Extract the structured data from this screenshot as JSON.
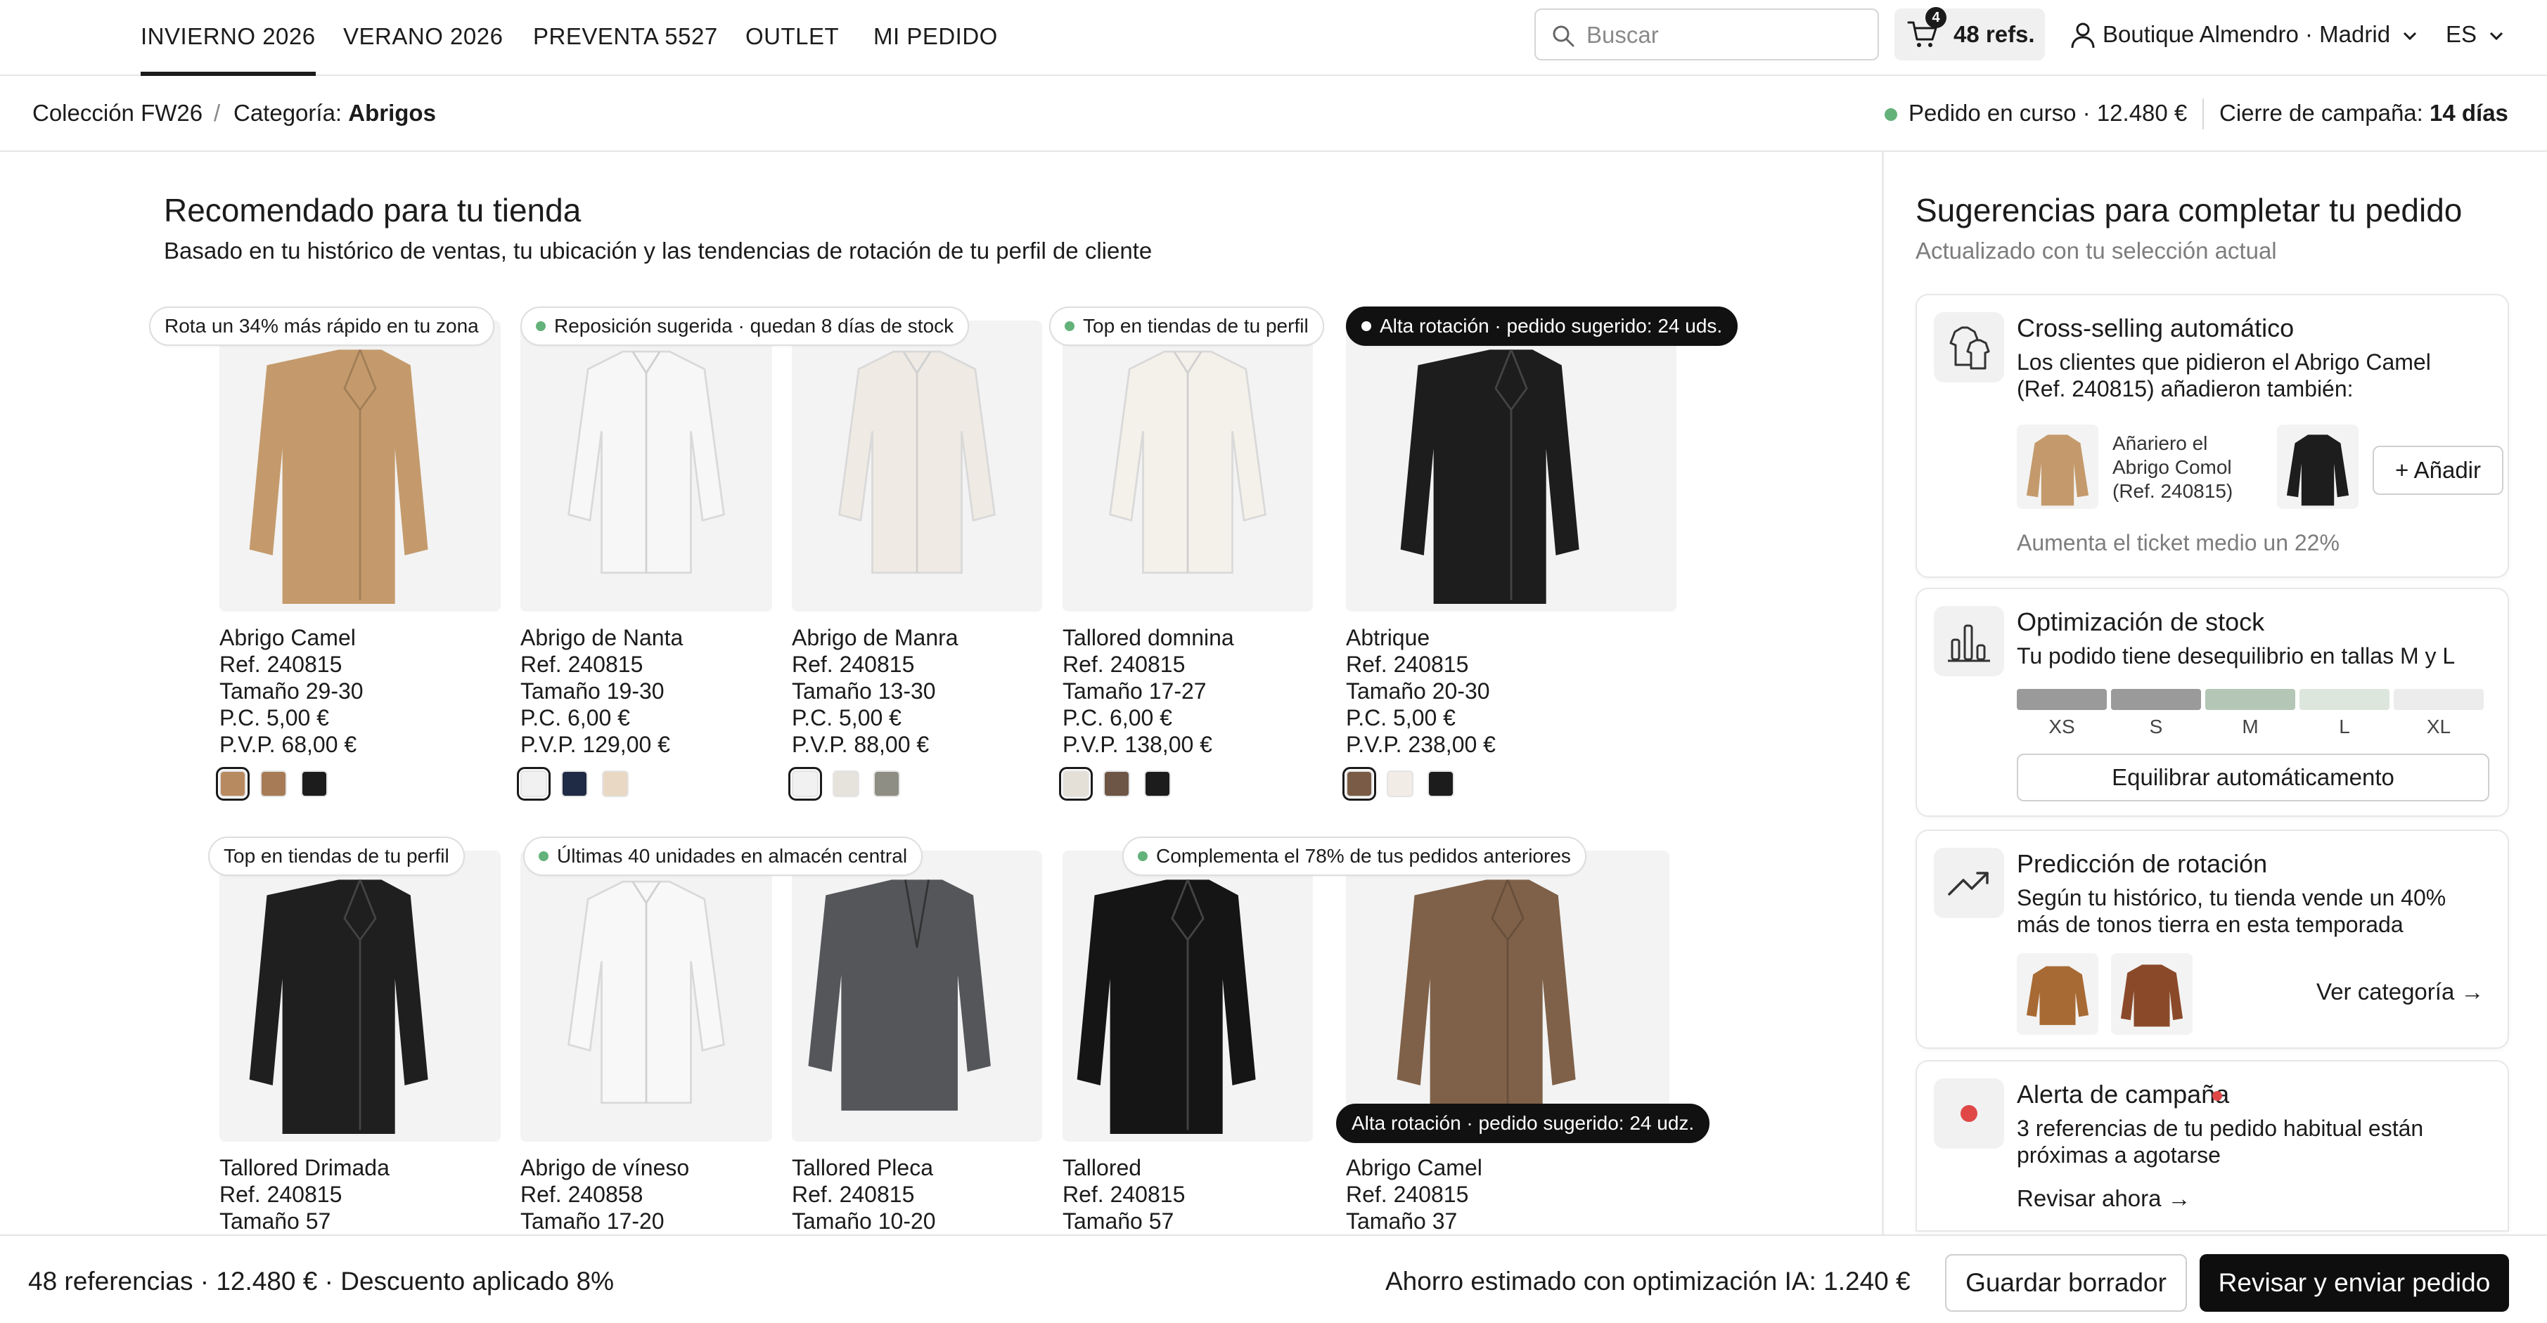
{
  "nav": {
    "tabs": [
      "INVIERNO 2026",
      "VERANO 2026",
      "PREVENTA 5527",
      "OUTLET",
      "MI PEDIDO"
    ],
    "search_placeholder": "Buscar",
    "cart_count": "4",
    "cart_label": "48 refs.",
    "store": "Boutique Almendro · Madrid",
    "lang": "ES"
  },
  "breadcrumb": {
    "collection": "Colección FW26",
    "sep": "/",
    "category_label": "Categoría:",
    "category_value": "Abrigos",
    "order_status": "Pedido en curso · 12.480 €",
    "campaign_label": "Cierre de campaña:",
    "campaign_value": "14 días"
  },
  "main": {
    "title": "Recomendado para tu tienda",
    "subtitle": "Basado en tu histórico de ventas, tu ubicación y las tendencias de rotación de tu perfil de cliente",
    "pills_row1": [
      {
        "text": "Rota un 34% más rápido en tu zona",
        "dot": false,
        "dark": false
      },
      {
        "text": "Reposición sugerida · quedan 8 días de stock",
        "dot": true,
        "dark": false
      },
      {
        "text": "Top en tiendas de tu perfil",
        "dot": true,
        "dark": false
      },
      {
        "text": "Alta rotación · pedido sugerido: 24 uds.",
        "dot": true,
        "dark": true
      }
    ],
    "pills_row2": [
      {
        "text": "Top en tiendas de tu perfil",
        "dot": false,
        "dark": false
      },
      {
        "text": "Últimas 40 unidades en almacén central",
        "dot": true,
        "dark": false
      },
      {
        "text": "Complementa el 78% de tus pedidos anteriores",
        "dot": true,
        "dark": false
      },
      {
        "text": "Alta rotación · pedido sugerido: 24 udz.",
        "dot": false,
        "dark": true
      }
    ],
    "products_row1": [
      {
        "name": "Abrigo Camel",
        "ref": "Ref. 240815",
        "size": "Tamaño 29-30",
        "pc": "P.C. 5,00 €",
        "pvp": "P.V.P. 68,00 €",
        "garment": "coat",
        "color": "#c49a6c",
        "swatches": [
          "#b88a5f",
          "#a77b56",
          "#1c1c1c"
        ]
      },
      {
        "name": "Abrigo de Nanta",
        "ref": "Ref. 240815",
        "size": "Tamaño 19-30",
        "pc": "P.C. 6,00 €",
        "pvp": "P.V.P. 129,00 €",
        "garment": "shirt",
        "color": "#f7f7f7",
        "swatches": [
          "#f1f1f1",
          "#1f2a44",
          "#e8d8c4"
        ]
      },
      {
        "name": "Abrigo de Manra",
        "ref": "Ref. 240815",
        "size": "Tamaño 13-30",
        "pc": "P.C. 5,00 €",
        "pvp": "P.V.P. 88,00 €",
        "garment": "shirt",
        "color": "#efebe4",
        "swatches": [
          "#f1f1f1",
          "#e6e2dc",
          "#8e8e84"
        ]
      },
      {
        "name": "Tallored domnina",
        "ref": "Ref. 240815",
        "size": "Tamaño 17-27",
        "pc": "P.C. 6,00 €",
        "pvp": "P.V.P. 138,00 €",
        "garment": "shirt",
        "color": "#f4f1ea",
        "swatches": [
          "#e4e0d8",
          "#6e5646",
          "#1c1c1c"
        ]
      },
      {
        "name": "Abtrique",
        "ref": "Ref. 240815",
        "size": "Tamaño 20-30",
        "pc": "P.C. 5,00 €",
        "pvp": "P.V.P. 238,00 €",
        "garment": "coat",
        "color": "#1d1d1d",
        "swatches": [
          "#7a5b45",
          "#f1ede6",
          "#1c1c1c"
        ]
      }
    ],
    "products_row2": [
      {
        "name": "Tallored Drimada",
        "ref": "Ref. 240815",
        "size": "Tamaño 57",
        "garment": "coat",
        "color": "#1f1f1f"
      },
      {
        "name": "Abrigo de víneso",
        "ref": "Ref. 240858",
        "size": "Tamaño 17-20",
        "garment": "shirt",
        "color": "#f8f8f8"
      },
      {
        "name": "Tallored Pleca",
        "ref": "Ref. 240815",
        "size": "Tamaño 10-20",
        "garment": "blazer",
        "color": "#55565a"
      },
      {
        "name": "Tallored",
        "ref": "Ref. 240815",
        "size": "Tamaño 57",
        "garment": "coat",
        "color": "#151515"
      },
      {
        "name": "Abrigo Camel",
        "ref": "Ref. 240815",
        "size": "Tamaño 37",
        "garment": "coat",
        "color": "#7f6149"
      }
    ]
  },
  "side": {
    "title": "Sugerencias para completar tu pedido",
    "subtitle": "Actualizado con tu selección actual",
    "cross": {
      "title": "Cross-selling automático",
      "text1": "Los clientes que pidieron el Abrigo Camel",
      "text2": "(Ref. 240815) añadieron también:",
      "item_l1": "Añariero el",
      "item_l2": "Abrigo Comol",
      "item_l3": "(Ref. 240815)",
      "add": "+ Añadir",
      "note": "Aumenta el ticket medio un 22%"
    },
    "stock": {
      "title": "Optimización de stock",
      "text": "Tu podido tiene desequilibrio en tallas M y L",
      "sizes": [
        "XS",
        "S",
        "M",
        "L",
        "XL"
      ],
      "size_colors": [
        "#9a9a9a",
        "#9a9a9a",
        "#b4c7b6",
        "#dde6dd",
        "#ececec"
      ],
      "button": "Equilibrar automáticamento"
    },
    "prediction": {
      "title": "Predicción de rotación",
      "text1": "Según tu histórico, tu tienda vende un 40%",
      "text2": "más de tonos tierra en esta temporada",
      "link": "Ver categoría →"
    },
    "alert": {
      "title": "Alerta de campaña",
      "text1": "3 referencias de tu pedido habitual están",
      "text2": "próximas a agotarse",
      "link": "Revisar ahora →",
      "accent": "#e04848"
    }
  },
  "bottom": {
    "summary": "48 referencias · 12.480 € · Descuento aplicado 8%",
    "savings": "Ahorro estimado con optimización IA: 1.240 €",
    "draft": "Guardar borrador",
    "submit": "Revisar y enviar pedido"
  }
}
